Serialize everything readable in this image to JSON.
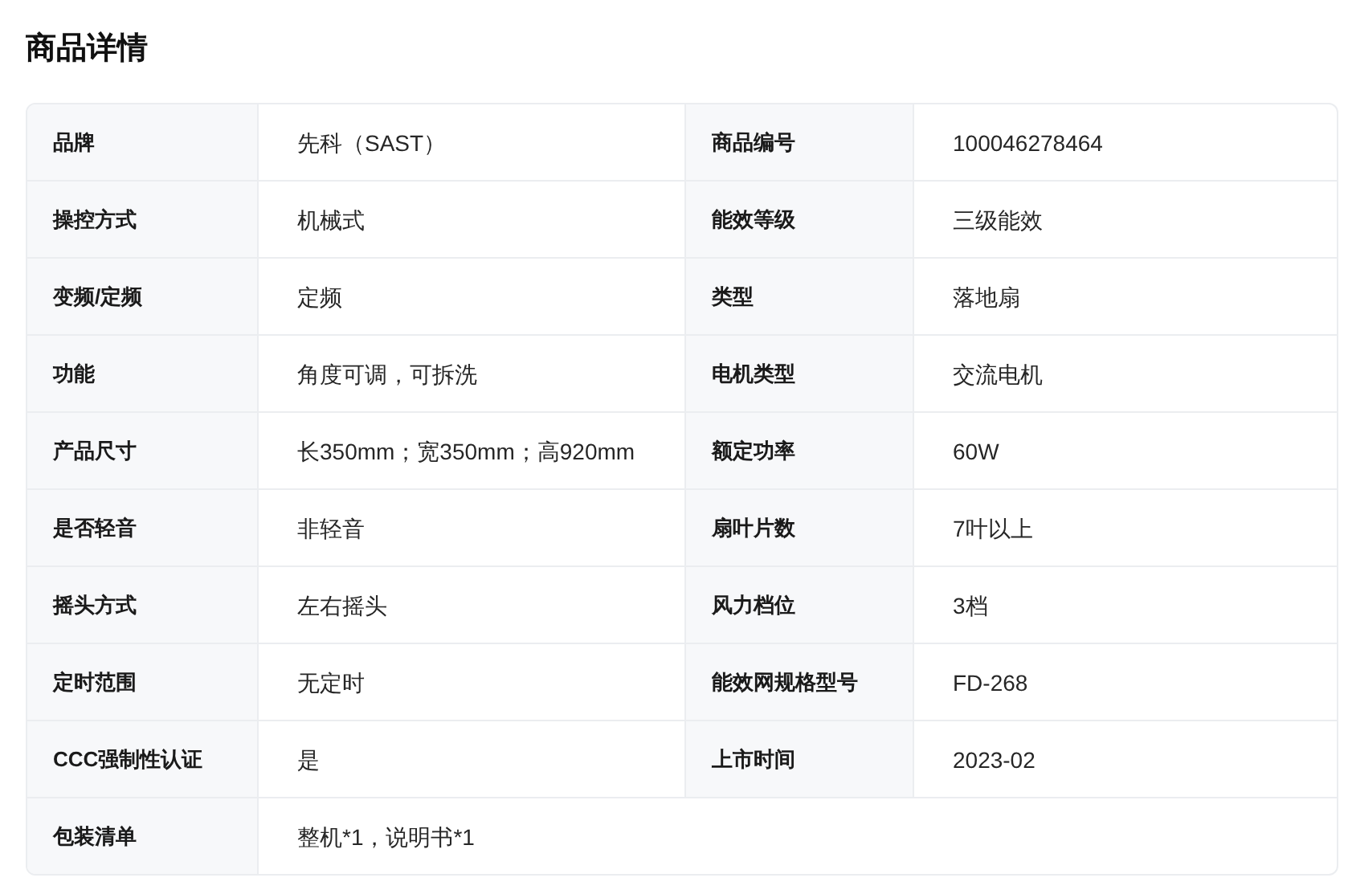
{
  "title": "商品详情",
  "spec_table": {
    "rows": [
      {
        "pairs": [
          {
            "label": "品牌",
            "value": "先科（SAST）"
          },
          {
            "label": "商品编号",
            "value": "100046278464"
          }
        ]
      },
      {
        "pairs": [
          {
            "label": "操控方式",
            "value": "机械式"
          },
          {
            "label": "能效等级",
            "value": "三级能效"
          }
        ]
      },
      {
        "pairs": [
          {
            "label": "变频/定频",
            "value": "定频"
          },
          {
            "label": "类型",
            "value": "落地扇"
          }
        ]
      },
      {
        "pairs": [
          {
            "label": "功能",
            "value": "角度可调，可拆洗"
          },
          {
            "label": "电机类型",
            "value": "交流电机"
          }
        ]
      },
      {
        "pairs": [
          {
            "label": "产品尺寸",
            "value": "长350mm；宽350mm；高920mm"
          },
          {
            "label": "额定功率",
            "value": "60W"
          }
        ]
      },
      {
        "pairs": [
          {
            "label": "是否轻音",
            "value": "非轻音"
          },
          {
            "label": "扇叶片数",
            "value": "7叶以上"
          }
        ]
      },
      {
        "pairs": [
          {
            "label": "摇头方式",
            "value": "左右摇头"
          },
          {
            "label": "风力档位",
            "value": "3档"
          }
        ]
      },
      {
        "pairs": [
          {
            "label": "定时范围",
            "value": "无定时"
          },
          {
            "label": "能效网规格型号",
            "value": "FD-268"
          }
        ]
      },
      {
        "pairs": [
          {
            "label": "CCC强制性认证",
            "value": "是"
          },
          {
            "label": "上市时间",
            "value": "2023-02"
          }
        ]
      },
      {
        "pairs": [
          {
            "label": "包装清单",
            "value": "整机*1，说明书*1"
          }
        ]
      }
    ]
  }
}
